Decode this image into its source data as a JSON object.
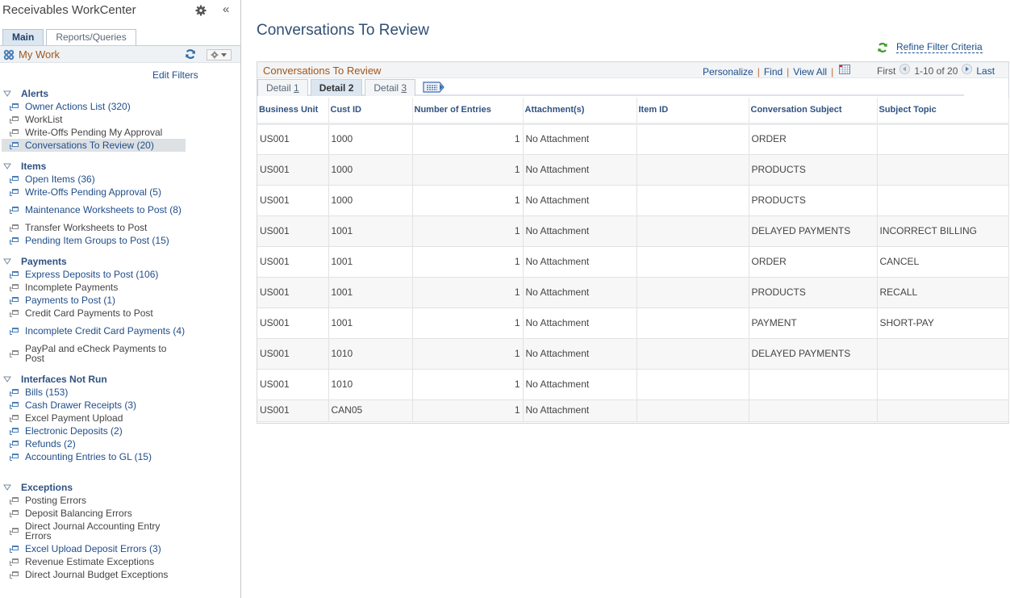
{
  "sidebar": {
    "title": "Receivables WorkCenter",
    "tabs": [
      {
        "label": "Main",
        "active": true
      },
      {
        "label": "Reports/Queries",
        "active": false
      }
    ],
    "my_work": "My Work",
    "edit_filters": "Edit Filters",
    "groups": [
      {
        "title": "Alerts",
        "items": [
          {
            "label": "Owner Actions List (320)",
            "link": true
          },
          {
            "label": "WorkList",
            "link": false
          },
          {
            "label": "Write-Offs Pending My Approval",
            "link": false
          },
          {
            "label": "Conversations To Review (20)",
            "link": true,
            "active": true
          }
        ]
      },
      {
        "title": "Items",
        "items": [
          {
            "label": "Open Items (36)",
            "link": true
          },
          {
            "label": "Write-Offs Pending Approval (5)",
            "link": true
          },
          {
            "label": "Maintenance Worksheets to Post (8)",
            "link": true
          },
          {
            "label": "Transfer Worksheets to Post",
            "link": false
          },
          {
            "label": "Pending Item Groups to Post (15)",
            "link": true
          }
        ]
      },
      {
        "title": "Payments",
        "items": [
          {
            "label": "Express Deposits to Post (106)",
            "link": true
          },
          {
            "label": "Incomplete Payments",
            "link": false
          },
          {
            "label": "Payments to Post (1)",
            "link": true
          },
          {
            "label": "Credit Card Payments to Post",
            "link": false
          },
          {
            "label": "Incomplete Credit Card Payments (4)",
            "link": true
          },
          {
            "label": "PayPal and eCheck Payments to Post",
            "link": false
          }
        ]
      },
      {
        "title": "Interfaces Not Run",
        "items": [
          {
            "label": "Bills (153)",
            "link": true
          },
          {
            "label": "Cash Drawer Receipts (3)",
            "link": true
          },
          {
            "label": "Excel Payment Upload",
            "link": false
          },
          {
            "label": "Electronic Deposits (2)",
            "link": true
          },
          {
            "label": "Refunds (2)",
            "link": true
          },
          {
            "label": "Accounting Entries to GL (15)",
            "link": true
          }
        ]
      },
      {
        "title": "Exceptions",
        "items": [
          {
            "label": "Posting Errors",
            "link": false
          },
          {
            "label": "Deposit Balancing Errors",
            "link": false
          },
          {
            "label": "Direct Journal Accounting Entry Errors",
            "link": false
          },
          {
            "label": "Excel Upload Deposit Errors (3)",
            "link": true
          },
          {
            "label": "Revenue Estimate Exceptions",
            "link": false
          },
          {
            "label": "Direct Journal Budget Exceptions",
            "link": false
          }
        ]
      }
    ]
  },
  "main": {
    "title": "Conversations To Review",
    "refine_filter": "Refine Filter Criteria",
    "grid": {
      "title": "Conversations To Review",
      "nav": {
        "personalize": "Personalize",
        "find": "Find",
        "view_all": "View All"
      },
      "pager": {
        "first": "First",
        "range": "1-10 of 20",
        "last": "Last"
      },
      "tabs": [
        {
          "label": "Detail ",
          "key": "1",
          "active": false
        },
        {
          "label": "Detail 2",
          "key": "",
          "active": true
        },
        {
          "label": "Detail ",
          "key": "3",
          "active": false
        }
      ],
      "columns": [
        "Business Unit",
        "Cust ID",
        "Number of Entries",
        "Attachment(s)",
        "Item ID",
        "Conversation Subject",
        "Subject Topic"
      ],
      "rows": [
        [
          "US001",
          "1000",
          "1",
          "No Attachment",
          "",
          "ORDER",
          ""
        ],
        [
          "US001",
          "1000",
          "1",
          "No Attachment",
          "",
          "PRODUCTS",
          ""
        ],
        [
          "US001",
          "1000",
          "1",
          "No Attachment",
          "",
          "PRODUCTS",
          ""
        ],
        [
          "US001",
          "1001",
          "1",
          "No Attachment",
          "",
          "DELAYED PAYMENTS",
          "INCORRECT BILLING"
        ],
        [
          "US001",
          "1001",
          "1",
          "No Attachment",
          "",
          "ORDER",
          "CANCEL"
        ],
        [
          "US001",
          "1001",
          "1",
          "No Attachment",
          "",
          "PRODUCTS",
          "RECALL"
        ],
        [
          "US001",
          "1001",
          "1",
          "No Attachment",
          "",
          "PAYMENT",
          "SHORT-PAY"
        ],
        [
          "US001",
          "1010",
          "1",
          "No Attachment",
          "",
          "DELAYED PAYMENTS",
          ""
        ],
        [
          "US001",
          "1010",
          "1",
          "No Attachment",
          "",
          "",
          ""
        ],
        [
          "US001",
          "CAN05",
          "1",
          "No Attachment",
          "",
          "",
          ""
        ]
      ]
    }
  },
  "colors": {
    "link": "#1f4d8a",
    "heading": "#305280",
    "accent_orange": "#a2561a",
    "active_tab_bg": "#dbe6f0"
  }
}
